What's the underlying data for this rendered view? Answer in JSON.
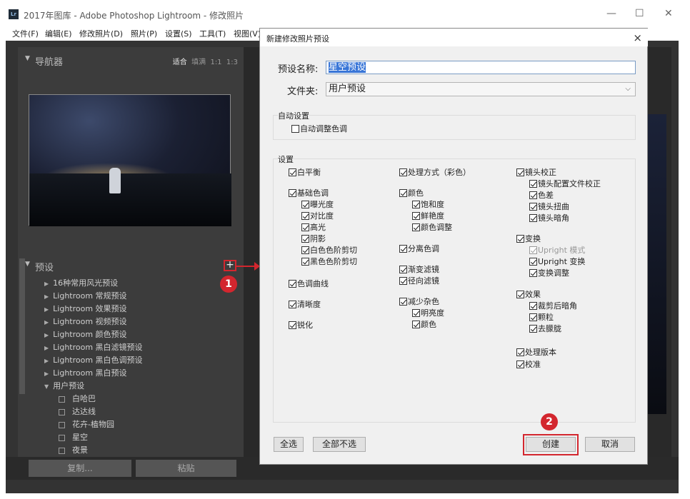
{
  "window": {
    "title": "2017年图库 - Adobe Photoshop Lightroom - 修改照片",
    "logo": "Lr"
  },
  "menu": [
    "文件(F)",
    "编辑(E)",
    "修改照片(D)",
    "照片(P)",
    "设置(S)",
    "工具(T)",
    "视图(V)"
  ],
  "navigator": {
    "title": "导航器",
    "zoom_opts": [
      "适合",
      "填满",
      "1:1",
      "1:3"
    ]
  },
  "presets": {
    "title": "预设",
    "add_button": "+",
    "folders": [
      "16种常用风光预设",
      "Lightroom 常规预设",
      "Lightroom 效果预设",
      "Lightroom 视频预设",
      "Lightroom 颜色预设",
      "Lightroom 黑白滤镜预设",
      "Lightroom 黑白色调预设",
      "Lightroom 黑白预设"
    ],
    "user_folder": "用户预设",
    "user_items": [
      "白哈巴",
      "达达线",
      "花卉-植物园",
      "星空",
      "夜景"
    ]
  },
  "bottom_buttons": {
    "copy": "复制...",
    "paste": "粘贴"
  },
  "annotations": {
    "step1": "1",
    "step2": "2"
  },
  "dialog": {
    "title": "新建修改照片预设",
    "close": "×",
    "name_label": "预设名称:",
    "name_value": "星空预设",
    "folder_label": "文件夹:",
    "folder_value": "用户预设",
    "auto_group": "自动设置",
    "auto_tone": "自动调整色调",
    "settings_group": "设置",
    "col1": [
      "白平衡",
      "基础色调",
      "曝光度",
      "对比度",
      "高光",
      "阴影",
      "白色色阶剪切",
      "黑色色阶剪切",
      "色调曲线",
      "清晰度",
      "锐化"
    ],
    "col2": [
      "处理方式（彩色）",
      "颜色",
      "饱和度",
      "鲜艳度",
      "颜色调整",
      "分离色调",
      "渐变滤镜",
      "径向滤镜",
      "减少杂色",
      "明亮度",
      "颜色"
    ],
    "col3": [
      "镜头校正",
      "镜头配置文件校正",
      "色差",
      "镜头扭曲",
      "镜头暗角",
      "变换",
      "Upright 模式",
      "Upright 变换",
      "变换调整",
      "效果",
      "裁剪后暗角",
      "颗粒",
      "去朦胧",
      "处理版本",
      "校准"
    ],
    "select_all": "全选",
    "select_none": "全部不选",
    "create": "创建",
    "cancel": "取消"
  }
}
